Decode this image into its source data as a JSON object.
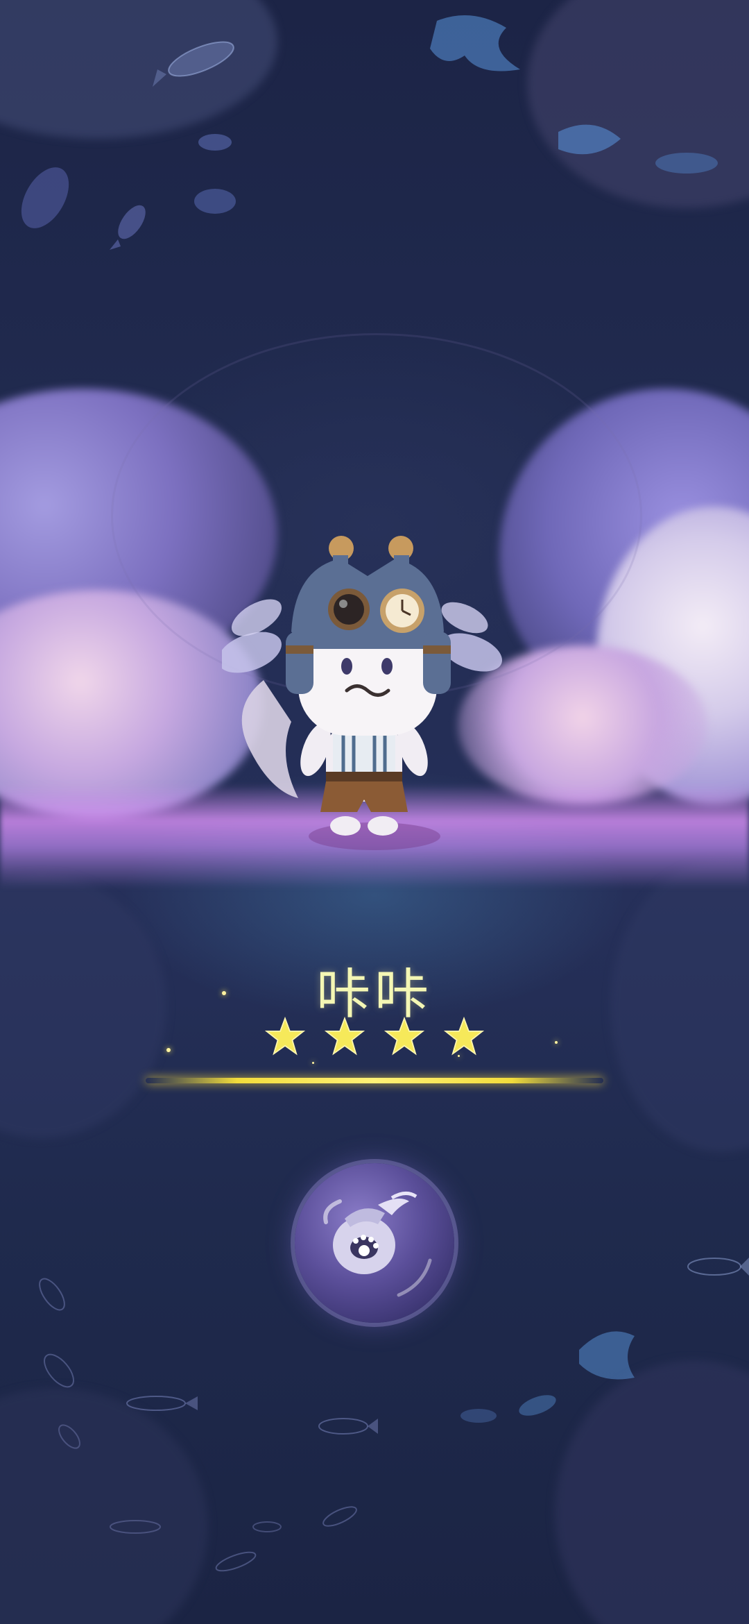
{
  "character": {
    "name": "咔咔",
    "stars": 4
  },
  "icons": {
    "star": "star-icon",
    "orb": "gift-bag-orb-icon"
  },
  "colors": {
    "background": "#1d2748",
    "name_text": "#f4f7b4",
    "star": "#f6e95a",
    "glow_line": "#f2dc3c",
    "horizon": "#d28cf0"
  }
}
